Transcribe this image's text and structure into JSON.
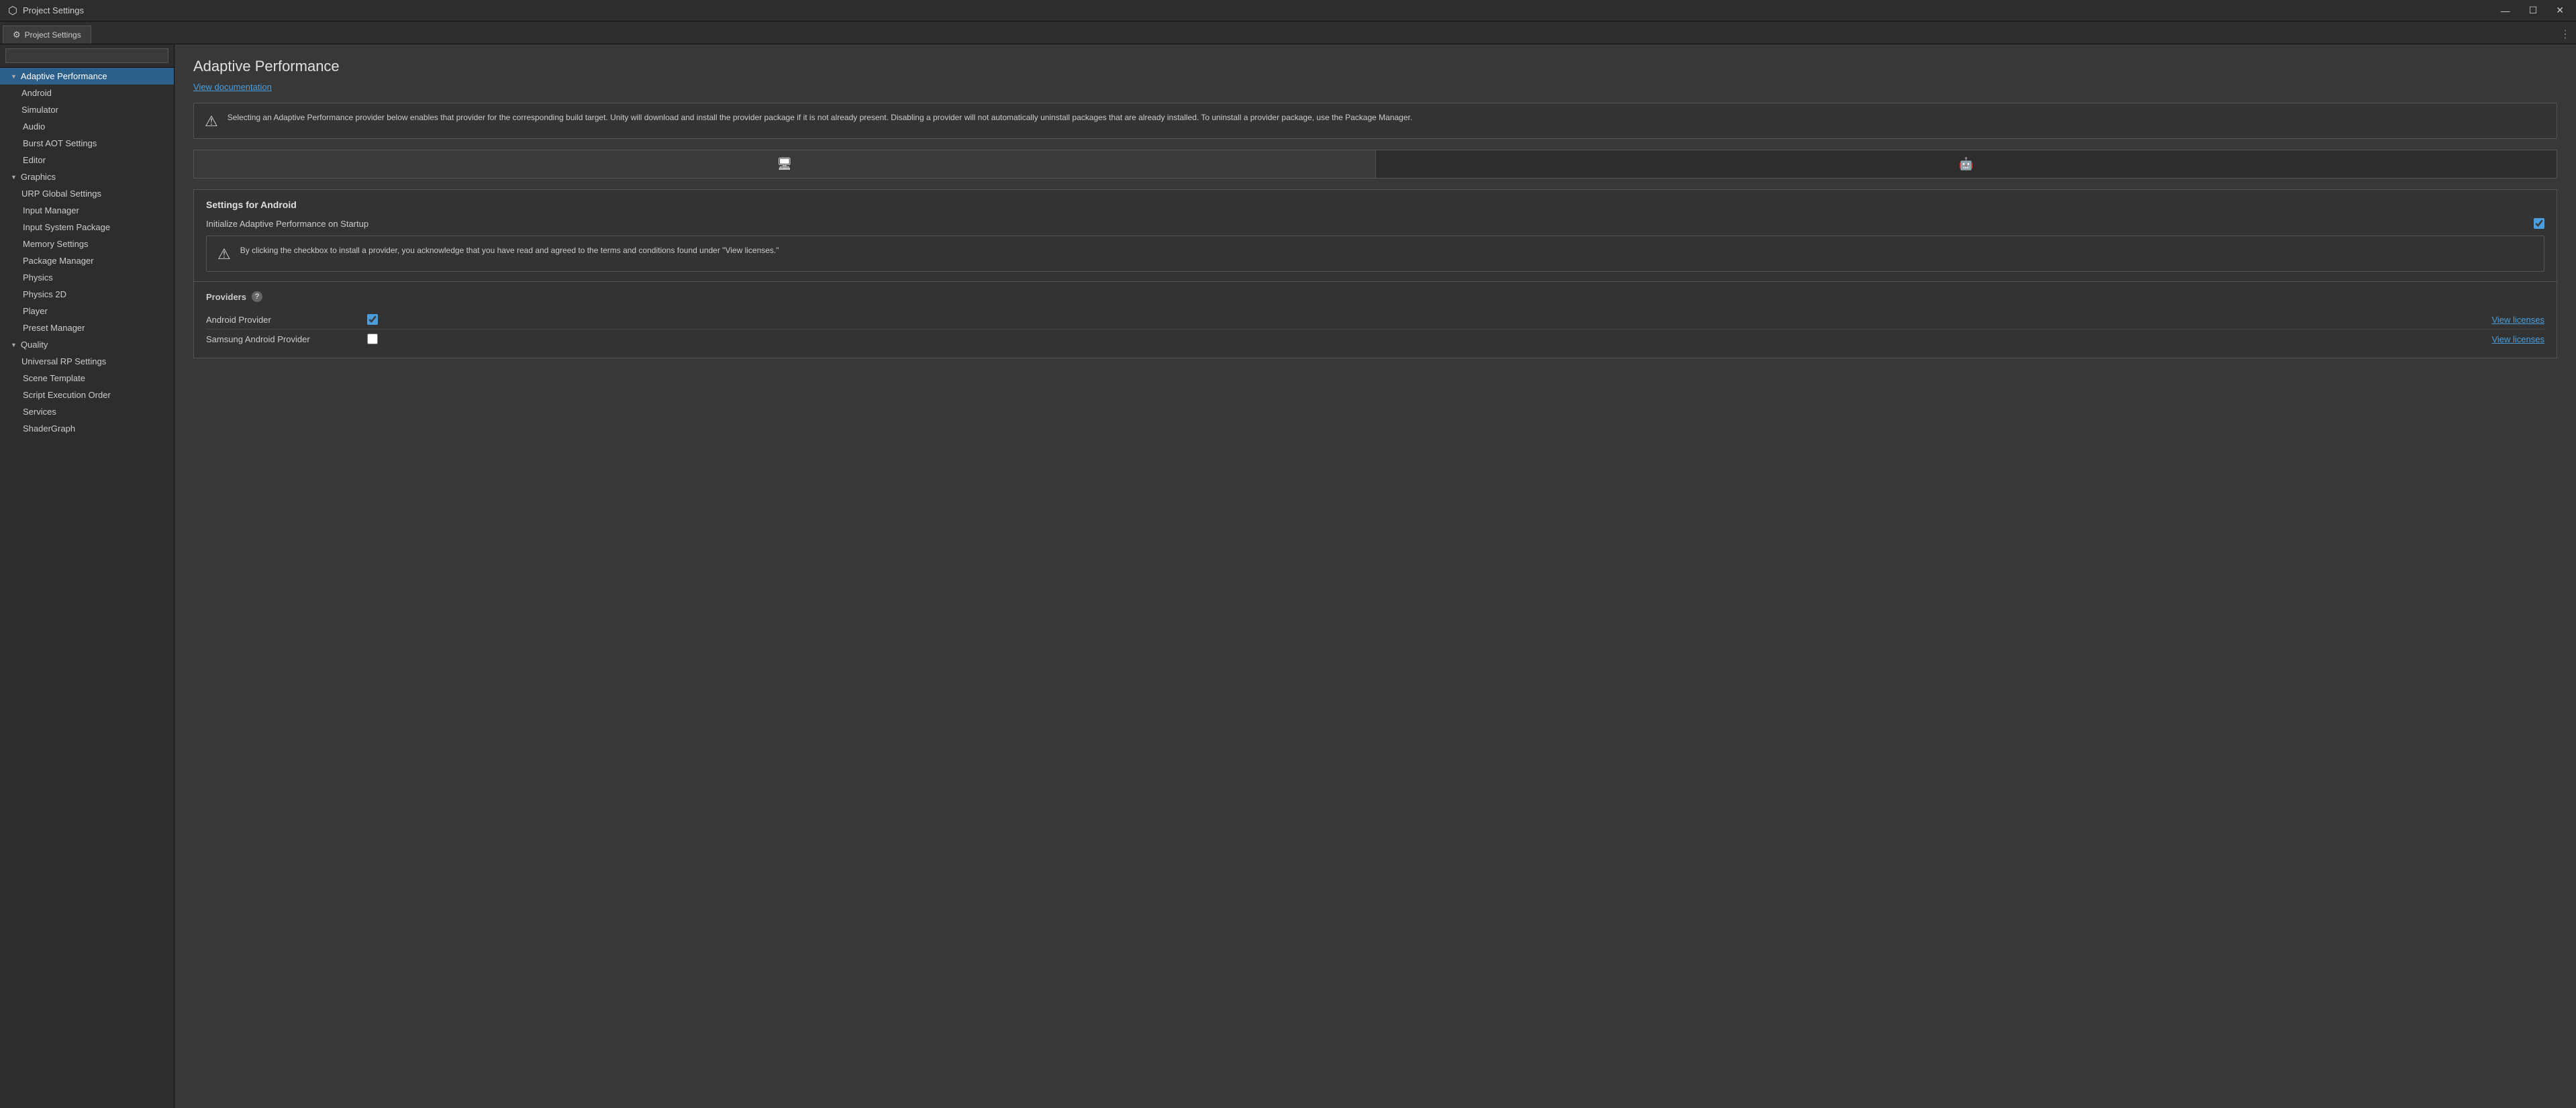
{
  "titleBar": {
    "icon": "⬡",
    "title": "Project Settings",
    "controls": {
      "minimize": "—",
      "maximize": "☐",
      "close": "✕"
    }
  },
  "tabBar": {
    "activeTab": "Project Settings",
    "gearIcon": "⚙",
    "moreIcon": "⋮"
  },
  "search": {
    "placeholder": ""
  },
  "sidebar": {
    "items": [
      {
        "id": "adaptive-performance",
        "label": "Adaptive Performance",
        "level": 0,
        "hasChildren": true,
        "active": true
      },
      {
        "id": "android",
        "label": "Android",
        "level": 1,
        "hasChildren": false,
        "active": false
      },
      {
        "id": "simulator",
        "label": "Simulator",
        "level": 1,
        "hasChildren": false,
        "active": false
      },
      {
        "id": "audio",
        "label": "Audio",
        "level": 0,
        "hasChildren": false,
        "active": false
      },
      {
        "id": "burst-aot",
        "label": "Burst AOT Settings",
        "level": 0,
        "hasChildren": false,
        "active": false
      },
      {
        "id": "editor",
        "label": "Editor",
        "level": 0,
        "hasChildren": false,
        "active": false
      },
      {
        "id": "graphics",
        "label": "Graphics",
        "level": 0,
        "hasChildren": true,
        "active": false
      },
      {
        "id": "urp-global",
        "label": "URP Global Settings",
        "level": 1,
        "hasChildren": false,
        "active": false
      },
      {
        "id": "input-manager",
        "label": "Input Manager",
        "level": 0,
        "hasChildren": false,
        "active": false
      },
      {
        "id": "input-system",
        "label": "Input System Package",
        "level": 0,
        "hasChildren": false,
        "active": false
      },
      {
        "id": "memory-settings",
        "label": "Memory Settings",
        "level": 0,
        "hasChildren": false,
        "active": false
      },
      {
        "id": "package-manager",
        "label": "Package Manager",
        "level": 0,
        "hasChildren": false,
        "active": false
      },
      {
        "id": "physics",
        "label": "Physics",
        "level": 0,
        "hasChildren": false,
        "active": false
      },
      {
        "id": "physics-2d",
        "label": "Physics 2D",
        "level": 0,
        "hasChildren": false,
        "active": false
      },
      {
        "id": "player",
        "label": "Player",
        "level": 0,
        "hasChildren": false,
        "active": false
      },
      {
        "id": "preset-manager",
        "label": "Preset Manager",
        "level": 0,
        "hasChildren": false,
        "active": false
      },
      {
        "id": "quality",
        "label": "Quality",
        "level": 0,
        "hasChildren": true,
        "active": false
      },
      {
        "id": "universal-rp",
        "label": "Universal RP Settings",
        "level": 1,
        "hasChildren": false,
        "active": false
      },
      {
        "id": "scene-template",
        "label": "Scene Template",
        "level": 0,
        "hasChildren": false,
        "active": false
      },
      {
        "id": "script-execution",
        "label": "Script Execution Order",
        "level": 0,
        "hasChildren": false,
        "active": false
      },
      {
        "id": "services",
        "label": "Services",
        "level": 0,
        "hasChildren": false,
        "active": false
      },
      {
        "id": "shadergraph",
        "label": "ShaderGraph",
        "level": 0,
        "hasChildren": false,
        "active": false
      }
    ]
  },
  "content": {
    "title": "Adaptive Performance",
    "viewDocsLabel": "View documentation",
    "infoMessage": "Selecting an Adaptive Performance provider below enables that provider for the corresponding build target. Unity will download and install the provider package if it is not already present. Disabling a provider will not automatically uninstall packages that are already installed. To uninstall a provider package, use the Package Manager.",
    "platformTabs": [
      {
        "id": "desktop",
        "icon": "🖥",
        "label": "Desktop",
        "active": true
      },
      {
        "id": "android",
        "icon": "🤖",
        "label": "Android",
        "active": false
      }
    ],
    "settingsSection": {
      "title": "Settings for Android",
      "initLabel": "Initialize Adaptive Performance on Startup",
      "initChecked": true
    },
    "warningMessage": "By clicking the checkbox to install a provider, you acknowledge that you have read and agreed to the terms and conditions found under \"View licenses.\"",
    "providers": {
      "title": "Providers",
      "helpTooltip": "?",
      "items": [
        {
          "id": "android-provider",
          "name": "Android Provider",
          "checked": true,
          "viewLicensesLabel": "View licenses"
        },
        {
          "id": "samsung-provider",
          "name": "Samsung Android Provider",
          "checked": false,
          "viewLicensesLabel": "View licenses"
        }
      ]
    }
  }
}
